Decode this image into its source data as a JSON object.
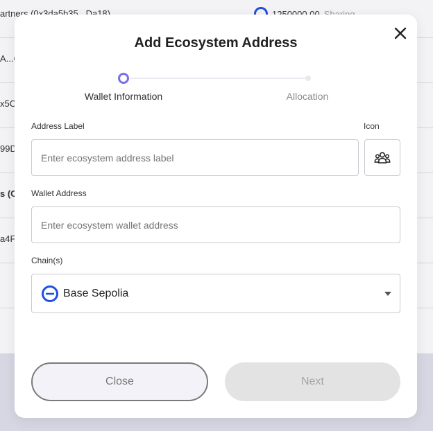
{
  "background": {
    "rows": [
      {
        "col_a": "artners (0x3da5b35...Da18)",
        "col_b_amount": "1250000.00",
        "col_b_status": "Sharing"
      },
      {
        "col_a": "A...C"
      },
      {
        "col_a": "x5O"
      },
      {
        "col_a": "99D"
      },
      {
        "col_a": "s (C"
      },
      {
        "col_a": "a4F"
      },
      {
        "col_a": ""
      }
    ]
  },
  "modal": {
    "title": "Add Ecosystem Address",
    "close_icon": "close-icon",
    "stepper": {
      "steps": [
        {
          "label": "Wallet Information",
          "state": "active"
        },
        {
          "label": "Allocation",
          "state": "inactive"
        }
      ],
      "active_color": "#7a70e8"
    },
    "address_label": {
      "label": "Address Label",
      "placeholder": "Enter ecosystem address label",
      "value": ""
    },
    "icon_picker": {
      "label": "Icon",
      "icon": "users-group-icon"
    },
    "wallet_address": {
      "label": "Wallet Address",
      "placeholder": "Enter ecosystem wallet address",
      "value": ""
    },
    "chain": {
      "label": "Chain(s)",
      "selected": "Base Sepolia",
      "icon": "base-chain-icon",
      "icon_color": "#1f4fe0"
    },
    "buttons": {
      "close": "Close",
      "next": "Next"
    }
  }
}
